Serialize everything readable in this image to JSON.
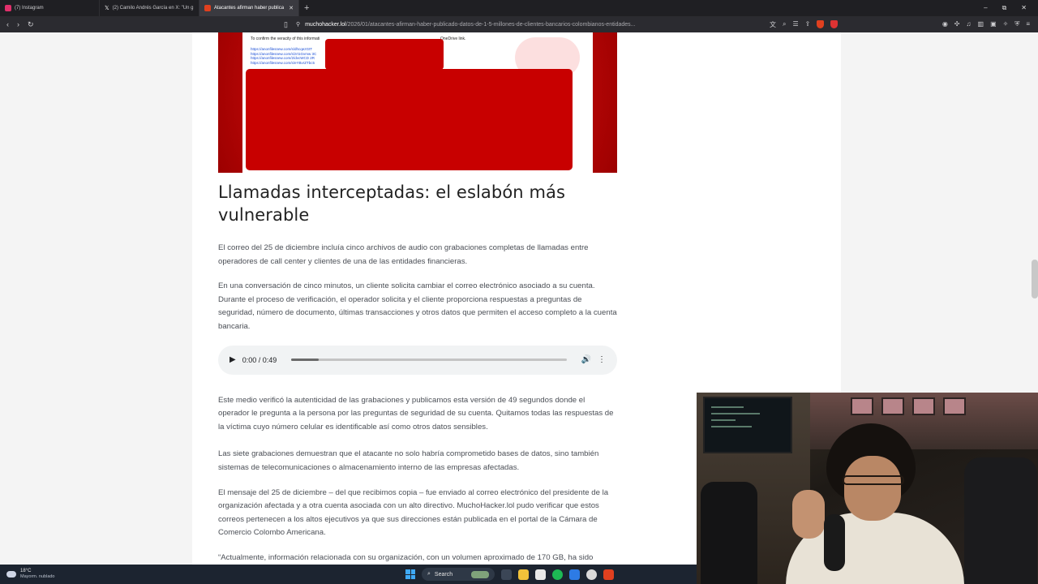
{
  "browser": {
    "tabs": [
      {
        "label": "(7) Instagram",
        "color": "#e1306c"
      },
      {
        "label": "(2) Camilo Andrés García en X: \"Un g",
        "color": "#ffffff"
      },
      {
        "label": "Atacantes afirman haber publica",
        "color": "#e0401f",
        "active": true
      }
    ],
    "new_tab": "+",
    "url_host": "muchohacker.lol",
    "url_path": "/2026/01/atacantes-afirman-haber-publicado-datos-de-1-5-millones-de-clientes-bancarios-colombianos-entidades...",
    "window_controls": [
      "–",
      "⧉",
      "✕"
    ]
  },
  "hero_image": {
    "doc_line": "To confirm the veracity of this informati",
    "doc_onedrive": "OneDrive link.",
    "doc_links": [
      "https://anonfilesnew.com/s/dhcqezGtT",
      "https://anonfilesnew.com/s/zrt1Gvmw 3C",
      "https://anonfilesnew.com/2/dvcWCD 2R",
      "https://anonfilesnew.com/s/eYBvrZTbc5"
    ]
  },
  "article": {
    "heading": "Llamadas interceptadas: el eslabón más vulnerable",
    "p1": "El correo del 25 de diciembre incluía cinco archivos de audio con grabaciones completas de llamadas entre operadores de call center y clientes de una de las entidades financieras.",
    "p2": "En una conversación de cinco minutos, un cliente solicita cambiar el correo electrónico asociado a su cuenta. Durante el proceso de verificación, el operador solicita y el cliente proporciona respuestas a preguntas de seguridad, número de documento, últimas transacciones y otros datos que permiten el acceso completo a la cuenta bancaria.",
    "audio": {
      "time": "0:00 / 0:49",
      "progress": 0.1
    },
    "p3": "Este medio verificó la autenticidad de las grabaciones y publicamos esta versión de 49 segundos donde el operador le pregunta a la persona por las preguntas de seguridad de su cuenta.  Quitamos todas las respuestas de la víctima cuyo número celular es identificable así como otros datos sensibles.",
    "p4": "Las siete grabaciones demuestran que el atacante no solo habría comprometido bases de datos, sino también sistemas de telecomunicaciones o almacenamiento interno de las empresas afectadas.",
    "p5": "El mensaje del 25 de diciembre – del que recibimos copia – fue enviado al correo electrónico del presidente de la organización afectada y a otra cuenta asociada con un alto directivo. MuchoHacker.lol pudo verificar que estos correos pertenecen a los altos ejecutivos ya que sus direcciones están publicada en el portal de la Cámara de Comercio Colombo Americana.",
    "p6": "“Actualmente, información relacionada con su organización, con un volumen aproximado de 170 GB, ha sido publicada en la dark web. Esto incluye documentos de identificación, bases de datos, grabaciones de audio y"
  },
  "taskbar": {
    "temp": "18°C",
    "weather": "Mayorm. nublado",
    "search": "Search"
  }
}
